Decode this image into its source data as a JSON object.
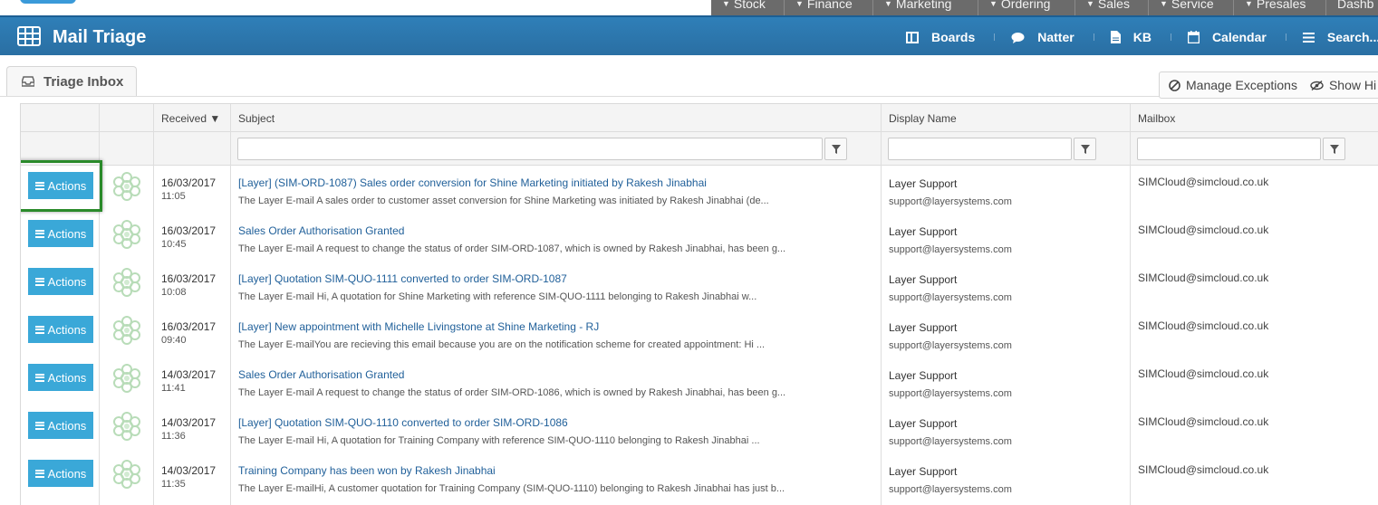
{
  "modules": [
    "Stock",
    "Finance",
    "Marketing",
    "Ordering",
    "Sales",
    "Service",
    "Presales",
    "Dashb"
  ],
  "header": {
    "title": "Mail Triage",
    "nav": [
      {
        "label": "Boards",
        "icon": "boards-icon"
      },
      {
        "label": "Natter",
        "icon": "chat-icon"
      },
      {
        "label": "KB",
        "icon": "document-icon"
      },
      {
        "label": "Calendar",
        "icon": "calendar-icon"
      },
      {
        "label": "Search...",
        "icon": "menu-icon"
      }
    ]
  },
  "tabs": {
    "triage_inbox": "Triage Inbox"
  },
  "toolbar": {
    "manage_exceptions": "Manage Exceptions",
    "show_hidden": "Show Hi"
  },
  "columns": {
    "received": "Received ▼",
    "subject": "Subject",
    "display_name": "Display Name",
    "mailbox": "Mailbox"
  },
  "actions_label": "Actions",
  "colors": {
    "accent": "#3aa8d8",
    "header": "#2a6fa3",
    "link": "#1f5f99",
    "highlight": "#2a8a2a"
  },
  "rows": [
    {
      "date": "16/03/2017",
      "time": "11:05",
      "subject": "[Layer] (SIM-ORD-1087) Sales order conversion for Shine Marketing initiated by Rakesh Jinabhai",
      "preview": "The Layer E-mail A sales order to customer asset conversion for Shine Marketing was initiated by Rakesh Jinabhai (de...",
      "display_name": "Layer Support",
      "email": "support@layersystems.com",
      "mailbox": "SIMCloud@simcloud.co.uk"
    },
    {
      "date": "16/03/2017",
      "time": "10:45",
      "subject": "Sales Order Authorisation Granted",
      "preview": "The Layer E-mail A request to change the status of order SIM-ORD-1087, which is owned by Rakesh Jinabhai, has been g...",
      "display_name": "Layer Support",
      "email": "support@layersystems.com",
      "mailbox": "SIMCloud@simcloud.co.uk"
    },
    {
      "date": "16/03/2017",
      "time": "10:08",
      "subject": "[Layer] Quotation SIM-QUO-1111 converted to order SIM-ORD-1087",
      "preview": "The Layer E-mail Hi, A quotation for Shine Marketing with reference SIM-QUO-1111 belonging to Rakesh Jinabhai w...",
      "display_name": "Layer Support",
      "email": "support@layersystems.com",
      "mailbox": "SIMCloud@simcloud.co.uk"
    },
    {
      "date": "16/03/2017",
      "time": "09:40",
      "subject": "[Layer] New appointment with Michelle Livingstone at Shine Marketing - RJ",
      "preview": "The Layer E-mailYou are recieving this email because you are on the notification scheme for created appointment: Hi ...",
      "display_name": "Layer Support",
      "email": "support@layersystems.com",
      "mailbox": "SIMCloud@simcloud.co.uk"
    },
    {
      "date": "14/03/2017",
      "time": "11:41",
      "subject": "Sales Order Authorisation Granted",
      "preview": "The Layer E-mail A request to change the status of order SIM-ORD-1086, which is owned by Rakesh Jinabhai, has been g...",
      "display_name": "Layer Support",
      "email": "support@layersystems.com",
      "mailbox": "SIMCloud@simcloud.co.uk"
    },
    {
      "date": "14/03/2017",
      "time": "11:36",
      "subject": "[Layer] Quotation SIM-QUO-1110 converted to order SIM-ORD-1086",
      "preview": "The Layer E-mail Hi, A quotation for Training Company with reference SIM-QUO-1110 belonging to Rakesh Jinabhai ...",
      "display_name": "Layer Support",
      "email": "support@layersystems.com",
      "mailbox": "SIMCloud@simcloud.co.uk"
    },
    {
      "date": "14/03/2017",
      "time": "11:35",
      "subject": "Training Company has been won by Rakesh Jinabhai",
      "preview": "The Layer E-mailHi, A customer quotation for Training Company (SIM-QUO-1110) belonging to Rakesh Jinabhai has just b...",
      "display_name": "Layer Support",
      "email": "support@layersystems.com",
      "mailbox": "SIMCloud@simcloud.co.uk"
    }
  ]
}
